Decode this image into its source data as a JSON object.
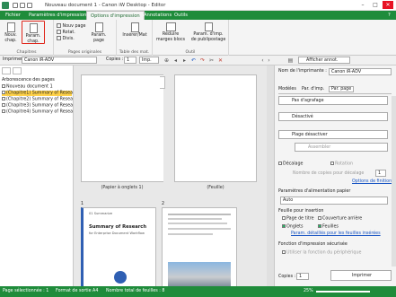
{
  "window": {
    "title": "Nouveau document 1 - Canon iW Desktop - Editor",
    "minimize": "–",
    "maximize": "□",
    "close": "✕"
  },
  "menu": {
    "tabs": [
      {
        "label": "Fichier"
      },
      {
        "label": "Paramètres d'impression"
      },
      {
        "label": "Options d'impression"
      },
      {
        "label": "Annotations"
      },
      {
        "label": "Outils"
      }
    ],
    "help": "?"
  },
  "ribbon": {
    "groups": [
      {
        "label": "Chapitres"
      },
      {
        "label": "Pages originales"
      },
      {
        "label": "Table des mat."
      },
      {
        "label": "Outil"
      }
    ],
    "btn_new_chapter": "Nouv. chap.",
    "btn_chapter_param": "Param. chap.",
    "btn_new_page": "Nouv page",
    "btn_rotate": "Rotat.",
    "btn_divide": "Divis.",
    "btn_page_param": "Param. page",
    "btn_insert_edit": "Insérer/Mat",
    "btn_reduce_margins": "Réduire marges blocs",
    "btn_param_print": "Param. d'imp. de publipostage"
  },
  "toolbar": {
    "printer_label": "Imprimer :",
    "printer_value": "Canon iR-ADV",
    "copies_label": "Copies :",
    "copies_value": "1",
    "print_btn": "Imp.",
    "show_annot": "Afficher annot."
  },
  "tree": {
    "header": "Arborescence des pages",
    "items": [
      "Nouveau document 1",
      "(Chapitre1) Summary of Resea",
      "(Chapitre2) Summary of Resea",
      "(Chapitre3) Summary of Resea",
      "(Chapitre4) Summary of Resea"
    ]
  },
  "pages": {
    "p1_label": "(Papier à onglets 1)",
    "p2_label": "(Feuille)",
    "num_a": "1",
    "num_b": "2",
    "doc_title": "Summary of Research",
    "doc_sub": "for Enterprise Document Workflow",
    "doc_header": "01 Summarize"
  },
  "right": {
    "printer_name_label": "Nom de l'imprimante :",
    "printer_name": "Canon iR-ADV",
    "tabs": [
      "Modèles",
      "Par. d'imp.",
      "Par. page"
    ],
    "dd_group": "Pas d'agrafage",
    "dd_disabled": "Désactivé",
    "dd_tray": "Plage désactiver",
    "dd_assemble": "Assembler",
    "offset_label": "Décalage",
    "rotation_label": "Rotation",
    "num_copies_shift": "Nombre de copies pour décalage",
    "num_copies_val": "1",
    "finishing_link": "Options de finition",
    "feed_section": "Paramètres d'alimentation papier",
    "feed_value": "Auto",
    "insert_section": "Feuille pour insertion",
    "cover_label": "Page de titre",
    "back_cover": "Couverture arrière",
    "tabs_label": "Onglets",
    "sheets_label": "Feuilles",
    "insert_link": "Param. détaillés pour les feuilles insérées",
    "secure_section": "Fonction d'impression sécurisée",
    "secure_use": "Utiliser la fonction du périphérique",
    "copies_label": "Copies :",
    "copies_val": "1",
    "print_btn": "Imprimer"
  },
  "status": {
    "selected": "Page sélectionnée : 1",
    "format": "Format de sortie A4",
    "total": "Nombre total de feuilles : 8",
    "zoom": "25%"
  }
}
